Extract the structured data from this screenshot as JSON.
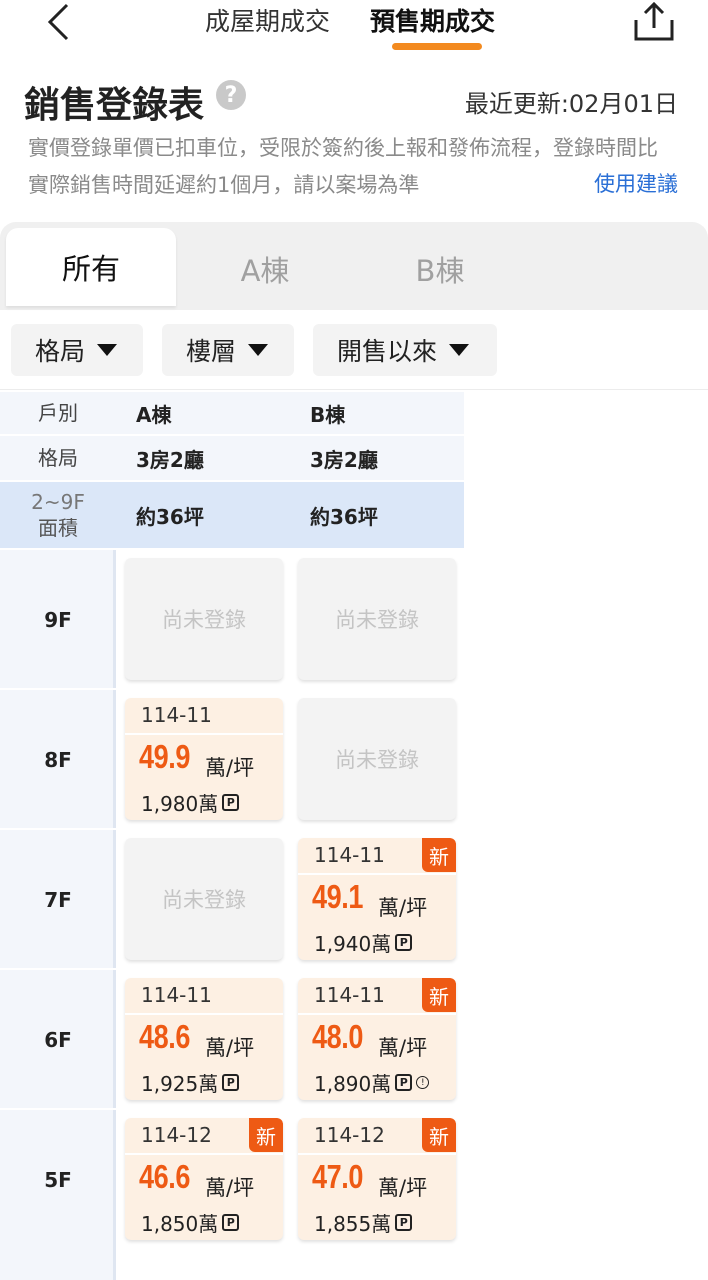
{
  "topnav": {
    "tab1": "成屋期成交",
    "tab2": "預售期成交",
    "accent": "#f38a1f"
  },
  "header": {
    "title": "銷售登錄表",
    "help": "?",
    "updated": "最近更新:02月01日",
    "note": "實價登錄單價已扣車位，受限於簽約後上報和發佈流程，登錄時間比實際銷售時間延遲約1個月，請以案場為準",
    "advice": "使用建議"
  },
  "building_tabs": [
    "所有",
    "A棟",
    "B棟"
  ],
  "filters": [
    "格局",
    "樓層",
    "開售以來"
  ],
  "table_header": {
    "row1_label": "戶別",
    "row2_label": "格局",
    "row3_label_top": "2~9F",
    "row3_label_bottom": "面積",
    "units": [
      {
        "name": "A棟",
        "layout": "3房2廳",
        "area": "約36坪"
      },
      {
        "name": "B棟",
        "layout": "3房2廳",
        "area": "約36坪"
      }
    ]
  },
  "empty_text": "尚未登錄",
  "new_text": "新",
  "unit_label": "萬/坪",
  "parking_icon": "P",
  "floors": [
    {
      "floor": "9F",
      "cells": [
        {
          "empty": true
        },
        {
          "empty": true
        }
      ]
    },
    {
      "floor": "8F",
      "cells": [
        {
          "empty": false,
          "date": "114-11",
          "price": "49.9",
          "total": "1,980萬",
          "new": false,
          "warn": false
        },
        {
          "empty": true
        }
      ]
    },
    {
      "floor": "7F",
      "cells": [
        {
          "empty": true
        },
        {
          "empty": false,
          "date": "114-11",
          "price": "49.1",
          "total": "1,940萬",
          "new": true,
          "warn": false
        }
      ]
    },
    {
      "floor": "6F",
      "cells": [
        {
          "empty": false,
          "date": "114-11",
          "price": "48.6",
          "total": "1,925萬",
          "new": false,
          "warn": false
        },
        {
          "empty": false,
          "date": "114-11",
          "price": "48.0",
          "total": "1,890萬",
          "new": true,
          "warn": true
        }
      ]
    },
    {
      "floor": "5F",
      "cells": [
        {
          "empty": false,
          "date": "114-12",
          "price": "46.6",
          "total": "1,850萬",
          "new": true,
          "warn": false
        },
        {
          "empty": false,
          "date": "114-12",
          "price": "47.0",
          "total": "1,855萬",
          "new": true,
          "warn": false
        }
      ]
    }
  ]
}
